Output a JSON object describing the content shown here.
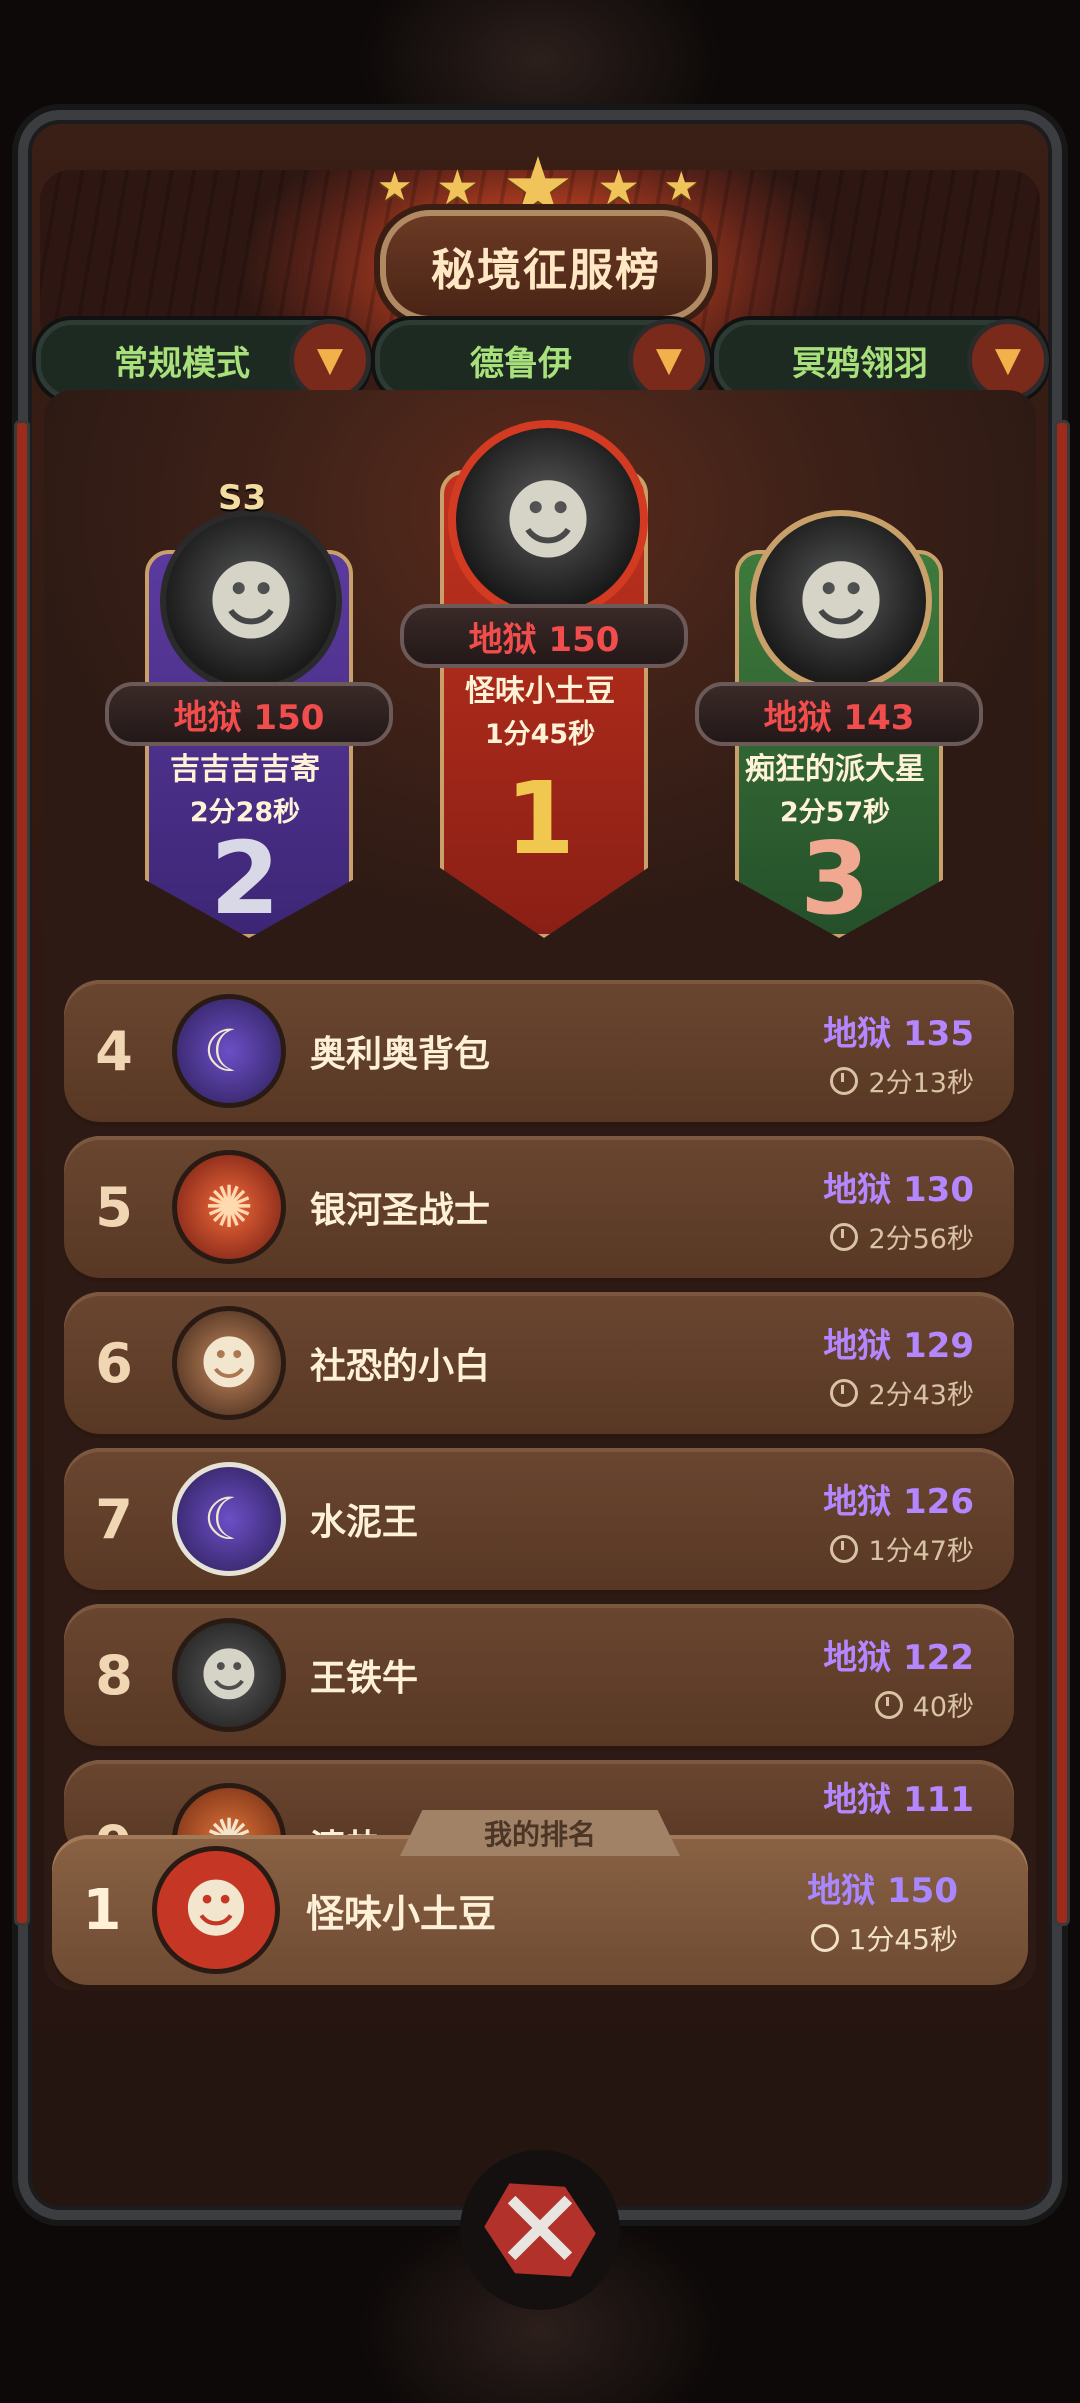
{
  "header": {
    "title": "秘境征服榜",
    "stars": [
      "★",
      "★",
      "★",
      "★",
      "★"
    ]
  },
  "filters": [
    {
      "label": "常规模式",
      "icon": "chevron-down-icon"
    },
    {
      "label": "德鲁伊",
      "icon": "chevron-down-icon"
    },
    {
      "label": "冥鸦翎羽",
      "icon": "chevron-down-icon"
    }
  ],
  "podium": {
    "first": {
      "rank": "1",
      "score": "地狱 150",
      "name": "怪味小土豆",
      "time": "1分45秒"
    },
    "second": {
      "rank": "2",
      "badge": "S3",
      "score": "地狱 150",
      "name": "吉吉吉吉寄",
      "time": "2分28秒"
    },
    "third": {
      "rank": "3",
      "score": "地狱 143",
      "name": "痴狂的派大星",
      "time": "2分57秒"
    }
  },
  "list": [
    {
      "rank": "4",
      "name": "奥利奥背包",
      "score": "地狱 135",
      "time": "2分13秒"
    },
    {
      "rank": "5",
      "name": "银河圣战士",
      "score": "地狱 130",
      "time": "2分56秒"
    },
    {
      "rank": "6",
      "name": "社恐的小白",
      "score": "地狱 129",
      "time": "2分43秒"
    },
    {
      "rank": "7",
      "name": "水泥王",
      "score": "地狱 126",
      "time": "1分47秒"
    },
    {
      "rank": "8",
      "name": "王铁牛",
      "score": "地狱 122",
      "time": "40秒"
    },
    {
      "rank": "9",
      "name": "清热",
      "score": "地狱 111",
      "time": ""
    }
  ],
  "my_rank": {
    "tag": "我的排名",
    "rank": "1",
    "name": "怪味小土豆",
    "score": "地狱 150",
    "time": "1分45秒"
  },
  "close_icon": "close-icon"
}
